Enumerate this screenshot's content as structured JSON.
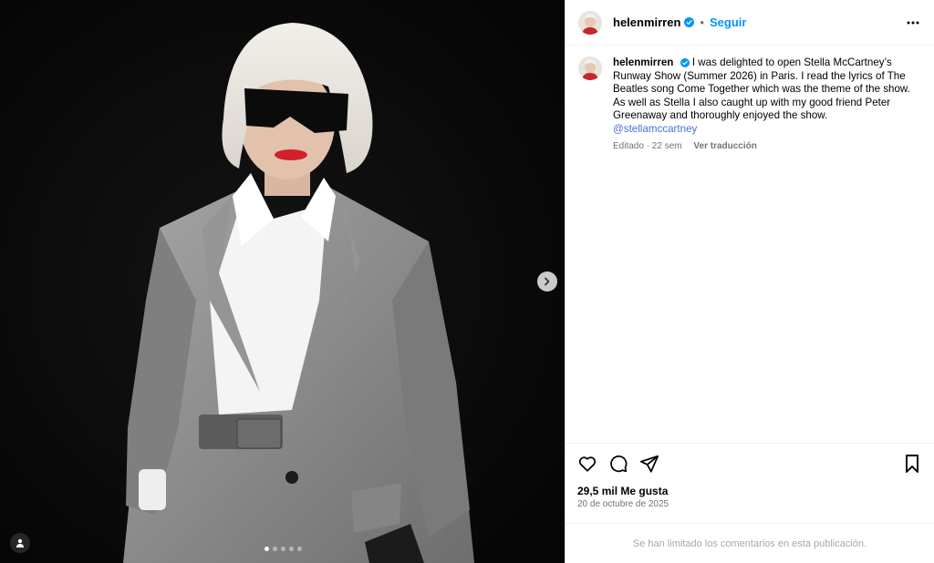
{
  "post": {
    "username": "helenmirren",
    "follow_label": "Seguir",
    "separator": "•",
    "caption_text": "I was delighted to open Stella McCartney’s Runway Show (Summer 2026) in Paris. I read the lyrics of The Beatles song Come Together which was the theme of the show. As well as Stella I also caught up with my good friend Peter Greenaway and thoroughly enjoyed the show.",
    "mention": "@stellamccartney",
    "meta_edited": "Editado · 22 sem",
    "translate_label": "Ver traducción",
    "likes": "29,5 mil Me gusta",
    "date": "20 de octubre de 2025",
    "comments_limited": "Se han limitado los comentarios en esta publicación."
  },
  "carousel": {
    "slide_count": 5,
    "active_index": 0
  },
  "colors": {
    "accent": "#0095f6",
    "verified": "#0095f6",
    "mention": "#4a6fd8"
  },
  "icons": [
    "verified-badge-icon",
    "more-options-icon",
    "heart-icon",
    "comment-icon",
    "share-icon",
    "bookmark-icon",
    "chevron-right-icon",
    "user-tag-icon"
  ]
}
